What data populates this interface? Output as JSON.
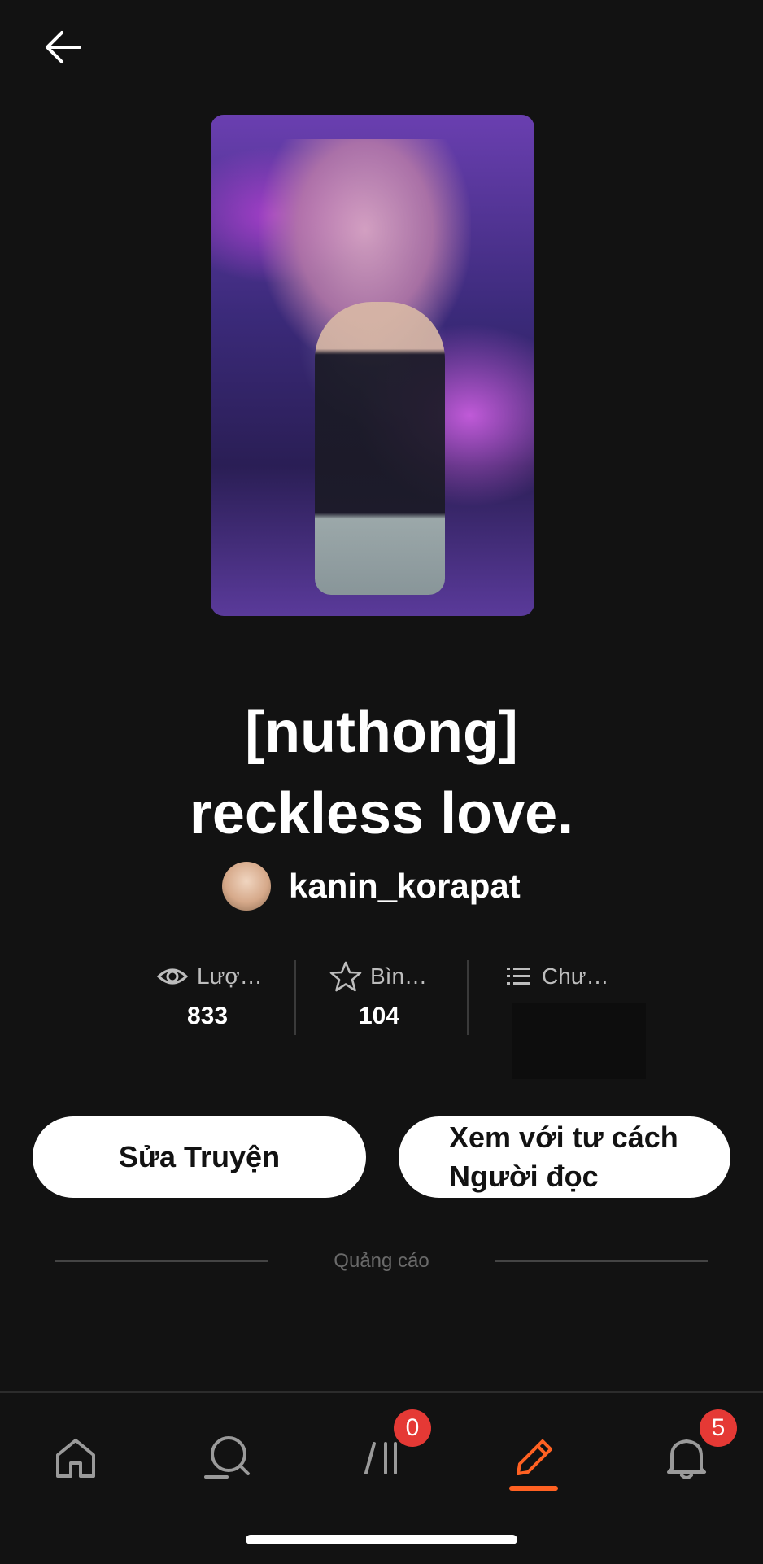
{
  "header": {
    "back_icon": "arrow-left-icon"
  },
  "story": {
    "title_line1": "[nuthong]",
    "title_line2": "reckless love.",
    "author": "kanin_korapat"
  },
  "stats": {
    "reads": {
      "label": "Lượ…",
      "value": "833",
      "icon": "eye-icon"
    },
    "votes": {
      "label": "Bìn…",
      "value": "104",
      "icon": "star-icon"
    },
    "parts": {
      "label": "Chư…",
      "icon": "list-icon"
    }
  },
  "actions": {
    "edit_label": "Sửa Truyện",
    "read_label": "Xem với tư cách\nNgười đọc"
  },
  "ad": {
    "label": "Quảng cáo"
  },
  "nav": {
    "items": [
      "home-icon",
      "search-icon",
      "library-icon",
      "write-icon",
      "bell-icon"
    ],
    "library_badge": "0",
    "notifications_badge": "5",
    "active": "write-icon"
  },
  "colors": {
    "background": "#121212",
    "accent": "#ff6122",
    "badge": "#e53935"
  }
}
